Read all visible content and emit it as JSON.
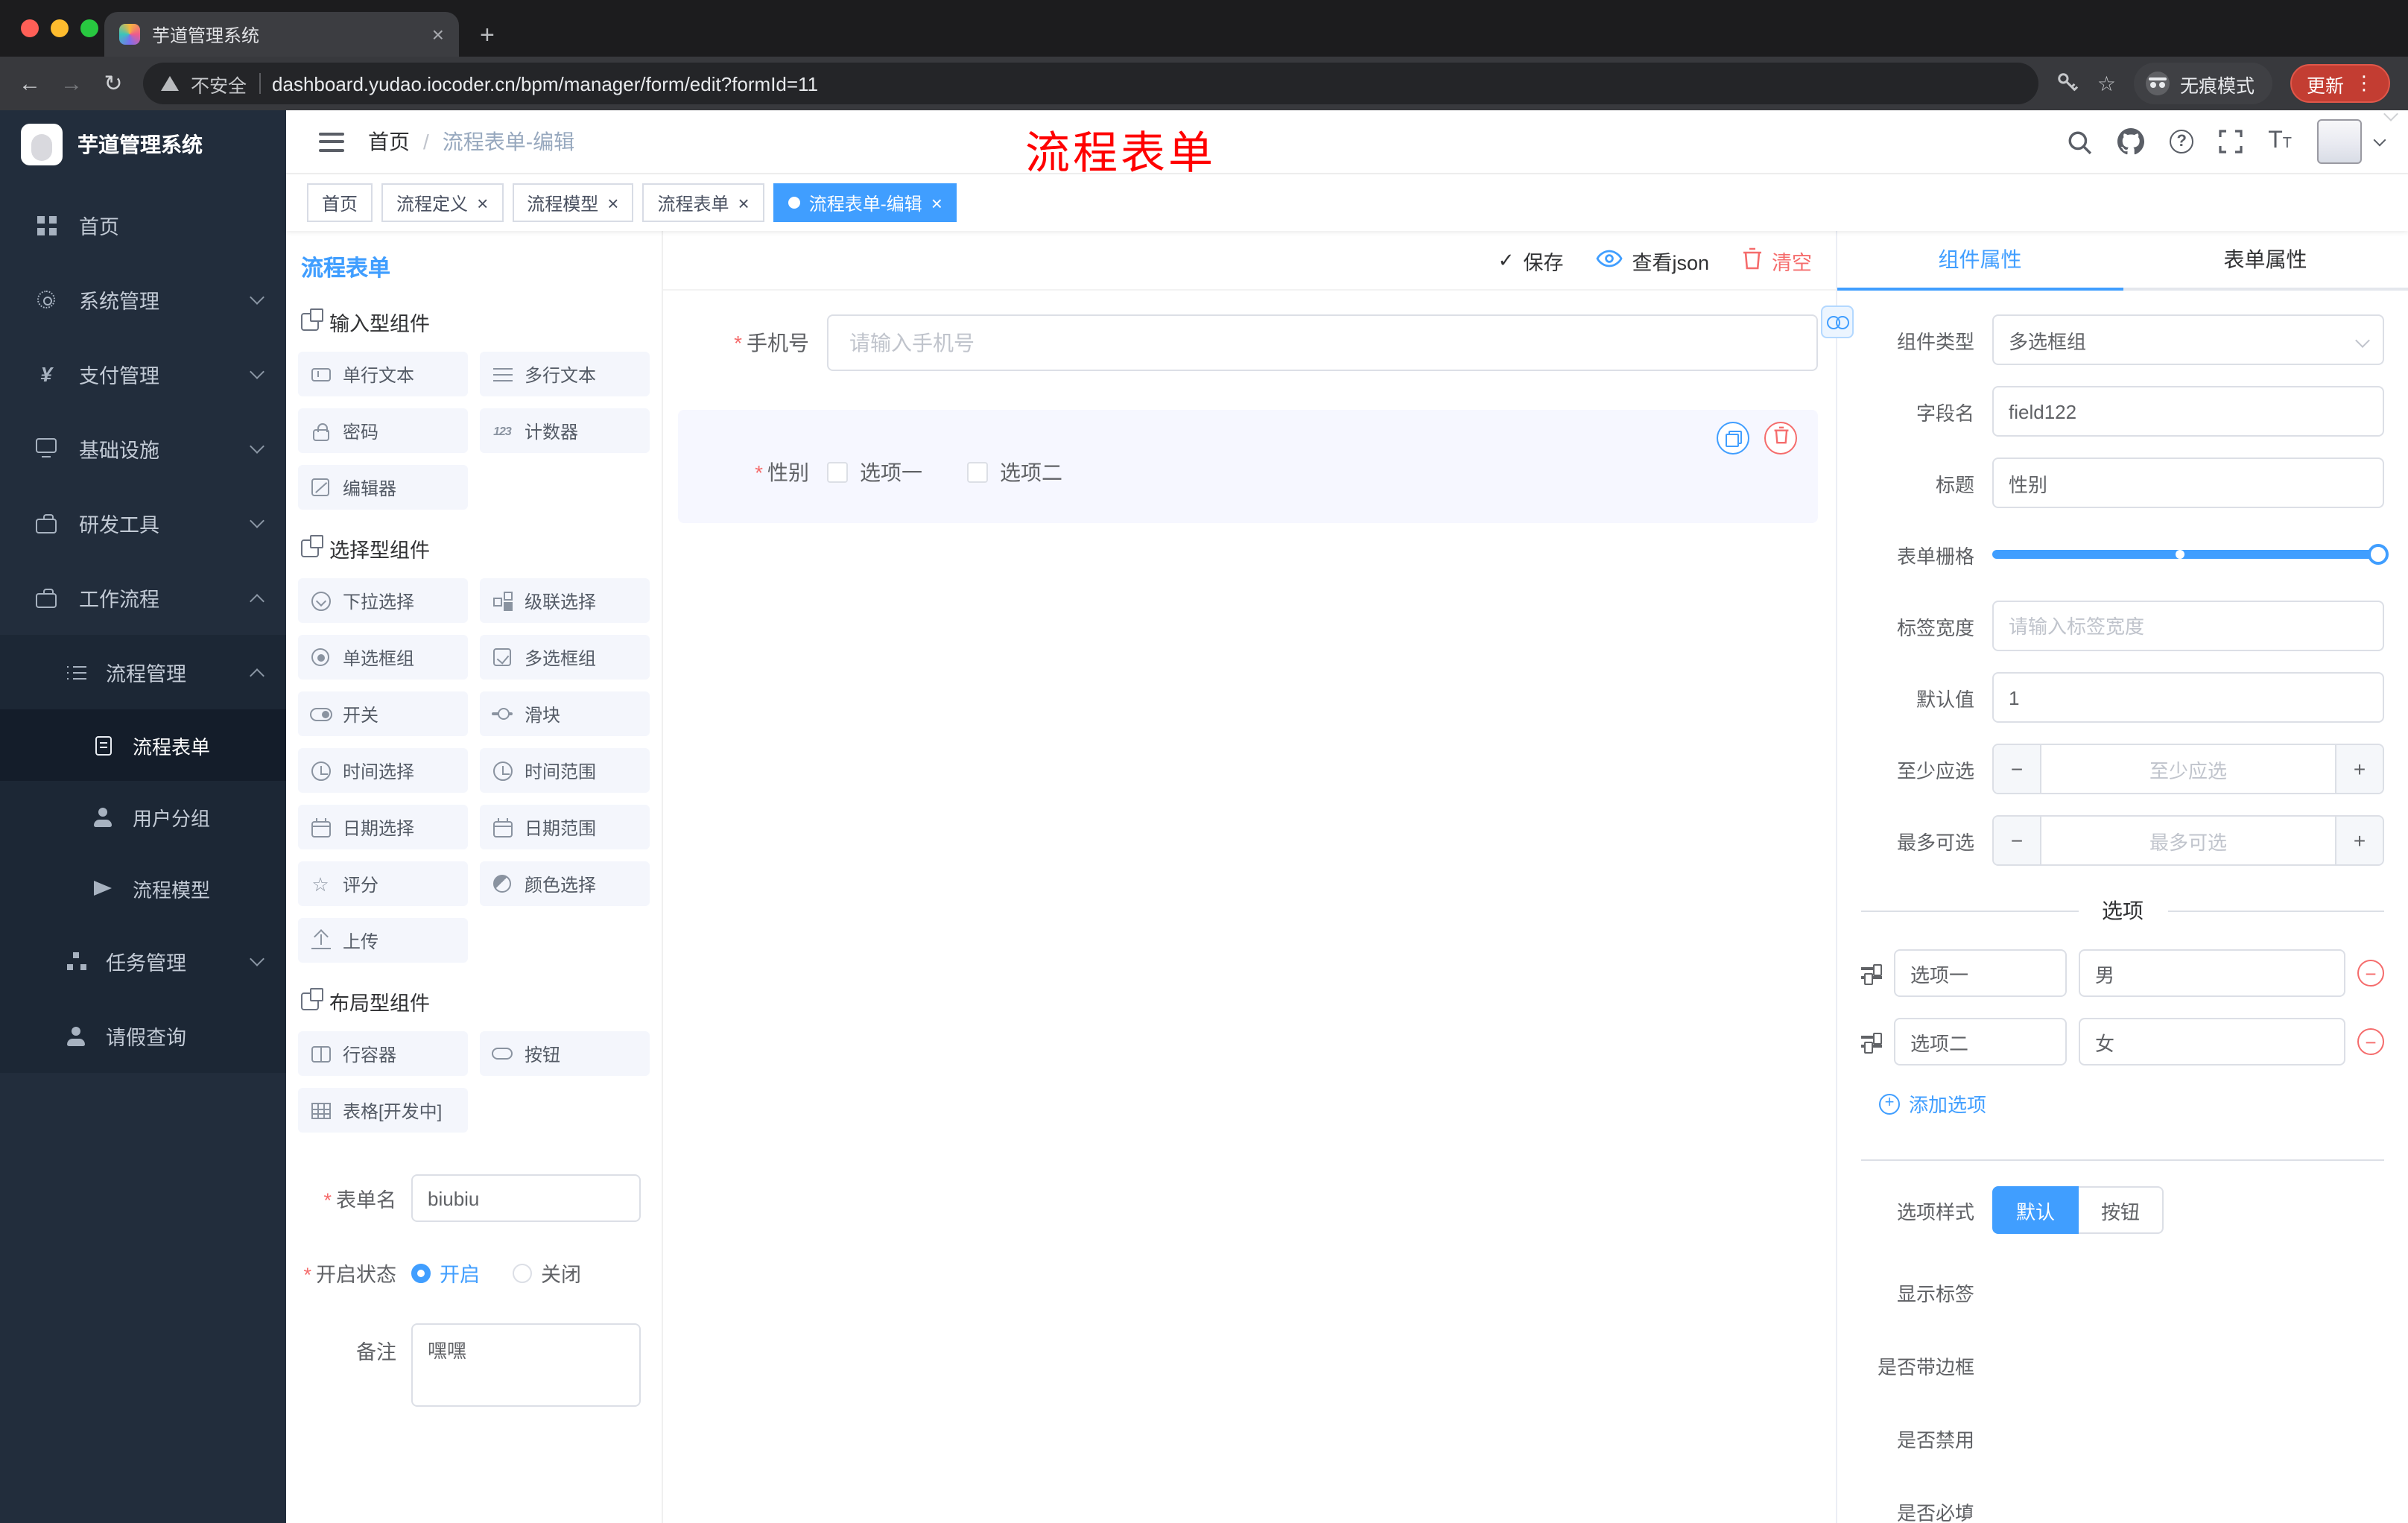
{
  "colors": {
    "primary": "#409eff",
    "danger": "#f56c6c",
    "annotation": "#ff0000",
    "sidebar_bg": "#222d3c"
  },
  "browser": {
    "tab_title": "芋道管理系统",
    "security_label": "不安全",
    "url": "dashboard.yudao.iocoder.cn/bpm/manager/form/edit?formId=11",
    "incognito_label": "无痕模式",
    "update_label": "更新"
  },
  "sidebar": {
    "logo_title": "芋道管理系统",
    "menu": [
      {
        "label": "首页"
      },
      {
        "label": "系统管理"
      },
      {
        "label": "支付管理"
      },
      {
        "label": "基础设施"
      },
      {
        "label": "研发工具"
      },
      {
        "label": "工作流程"
      },
      {
        "label": "流程管理"
      },
      {
        "label": "流程表单"
      },
      {
        "label": "用户分组"
      },
      {
        "label": "流程模型"
      },
      {
        "label": "任务管理"
      },
      {
        "label": "请假查询"
      }
    ]
  },
  "header": {
    "breadcrumb_home": "首页",
    "breadcrumb_current": "流程表单-编辑",
    "annotation": "流程表单"
  },
  "tags": [
    {
      "label": "首页"
    },
    {
      "label": "流程定义"
    },
    {
      "label": "流程模型"
    },
    {
      "label": "流程表单"
    },
    {
      "label": "流程表单-编辑"
    }
  ],
  "designer": {
    "title": "流程表单",
    "group_input": {
      "title": "输入型组件",
      "items": [
        "单行文本",
        "多行文本",
        "密码",
        "计数器",
        "编辑器"
      ]
    },
    "group_select": {
      "title": "选择型组件",
      "items": [
        "下拉选择",
        "级联选择",
        "单选框组",
        "多选框组",
        "开关",
        "滑块",
        "时间选择",
        "时间范围",
        "日期选择",
        "日期范围",
        "评分",
        "颜色选择",
        "上传"
      ]
    },
    "group_layout": {
      "title": "布局型组件",
      "items": [
        "行容器",
        "按钮",
        "表格[开发中]"
      ]
    },
    "form_name_label": "表单名",
    "form_name_value": "biubiu",
    "status_label": "开启状态",
    "status_on": "开启",
    "status_off": "关闭",
    "remark_label": "备注",
    "remark_value": "嘿嘿"
  },
  "canvas": {
    "save": "保存",
    "view_json": "查看json",
    "clear": "清空",
    "phone_label": "手机号",
    "phone_placeholder": "请输入手机号",
    "gender_label": "性别",
    "gender_option1": "选项一",
    "gender_option2": "选项二"
  },
  "props": {
    "tab_component": "组件属性",
    "tab_form": "表单属性",
    "type_label": "组件类型",
    "type_value": "多选框组",
    "field_label": "字段名",
    "field_value": "field122",
    "title_label": "标题",
    "title_value": "性别",
    "grid_label": "表单栅格",
    "width_label": "标签宽度",
    "width_placeholder": "请输入标签宽度",
    "default_label": "默认值",
    "default_value": "1",
    "min_label": "至少应选",
    "min_placeholder": "至少应选",
    "max_label": "最多可选",
    "max_placeholder": "最多可选",
    "options_title": "选项",
    "option1_label": "选项一",
    "option1_value": "男",
    "option2_label": "选项二",
    "option2_value": "女",
    "add_option": "添加选项",
    "style_label": "选项样式",
    "style_default": "默认",
    "style_button": "按钮",
    "show_label": "显示标签",
    "border_label": "是否带边框",
    "disabled_label": "是否禁用",
    "required_label": "是否必填"
  }
}
